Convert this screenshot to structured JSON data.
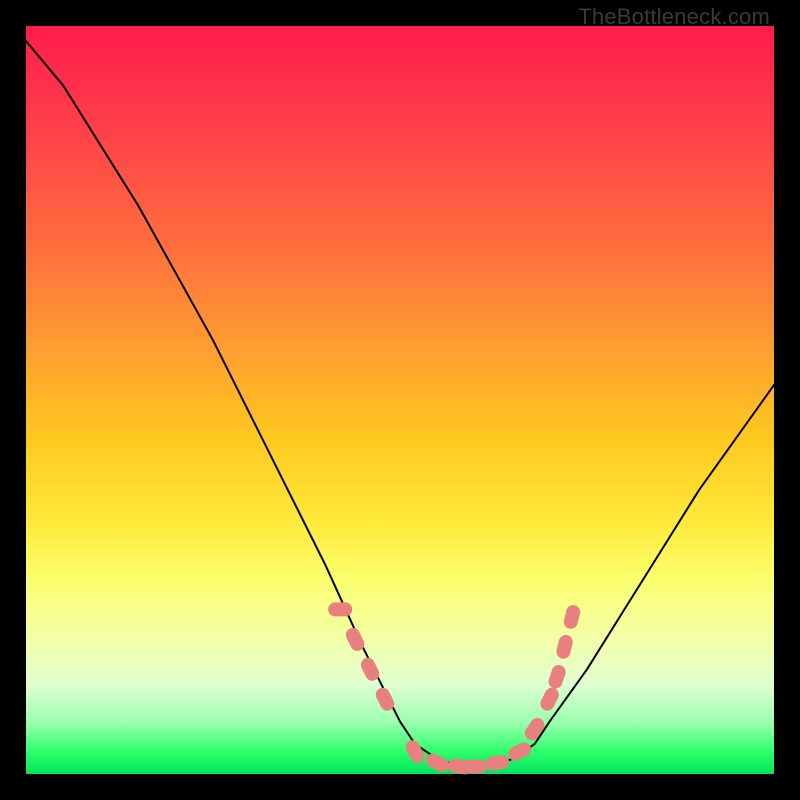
{
  "watermark": "TheBottleneck.com",
  "colors": {
    "background": "#000000",
    "marker": "#e88080",
    "curve": "#000000"
  },
  "chart_data": {
    "type": "line",
    "title": "",
    "xlabel": "",
    "ylabel": "",
    "xlim": [
      0,
      100
    ],
    "ylim": [
      0,
      100
    ],
    "grid": false,
    "series": [
      {
        "name": "bottleneck-curve",
        "x": [
          0,
          5,
          10,
          15,
          20,
          25,
          30,
          35,
          40,
          45,
          48,
          50,
          52,
          55,
          58,
          60,
          62,
          65,
          68,
          70,
          75,
          80,
          85,
          90,
          95,
          100
        ],
        "y": [
          98,
          92,
          84,
          76,
          67,
          58,
          48,
          38,
          28,
          17,
          11,
          7,
          4,
          2,
          1,
          1,
          1,
          2,
          4,
          7,
          14,
          22,
          30,
          38,
          45,
          52
        ]
      }
    ],
    "markers": {
      "name": "highlight-points",
      "x": [
        42,
        44,
        46,
        48,
        52,
        55,
        58,
        60,
        63,
        66,
        68,
        70,
        71,
        72,
        73
      ],
      "y": [
        22,
        18,
        14,
        10,
        3,
        1.5,
        1,
        1,
        1.5,
        3,
        6,
        10,
        13,
        17,
        21
      ]
    }
  }
}
